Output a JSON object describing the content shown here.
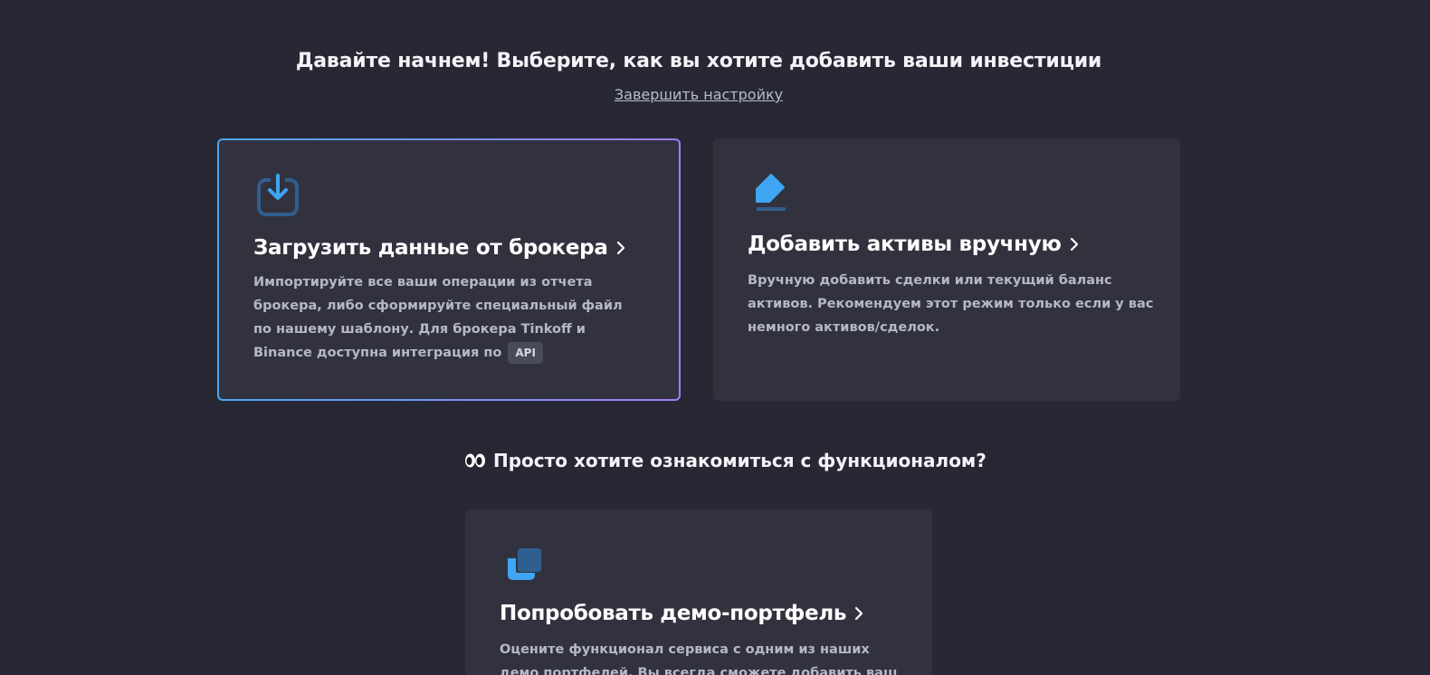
{
  "header": {
    "title": "Давайте начнем! Выберите, как вы хотите добавить ваши инвестиции",
    "finish_link": "Завершить настройку"
  },
  "cards": {
    "broker": {
      "icon": "download-icon",
      "title": "Загрузить данные от брокера",
      "description": "Импортируйте все ваши операции из отчета брокера, либо сформируйте специальный файл по нашему шаблону. Для брокера Tinkoff и Binance доступна интеграция по",
      "badge": "API"
    },
    "manual": {
      "icon": "pencil-icon",
      "title": "Добавить активы вручную",
      "description": "Вручную добавить сделки или текущий баланс активов. Рекомендуем этот режим только если у вас немного активов/сделок."
    },
    "demo": {
      "icon": "copy-icon",
      "title": "Попробовать демо-портфель",
      "description": "Оцените функционал сервиса с одним из наших демо портфелей. Вы всегда сможете добавить ваш портфель"
    }
  },
  "demo_section": {
    "icon": "eyes-icon",
    "heading": "Просто хотите ознакомиться с функционалом?"
  },
  "colors": {
    "background": "#272833",
    "card": "#32323f",
    "accent_blue": "#3ea6f2",
    "accent_purple": "#a47cf5"
  }
}
